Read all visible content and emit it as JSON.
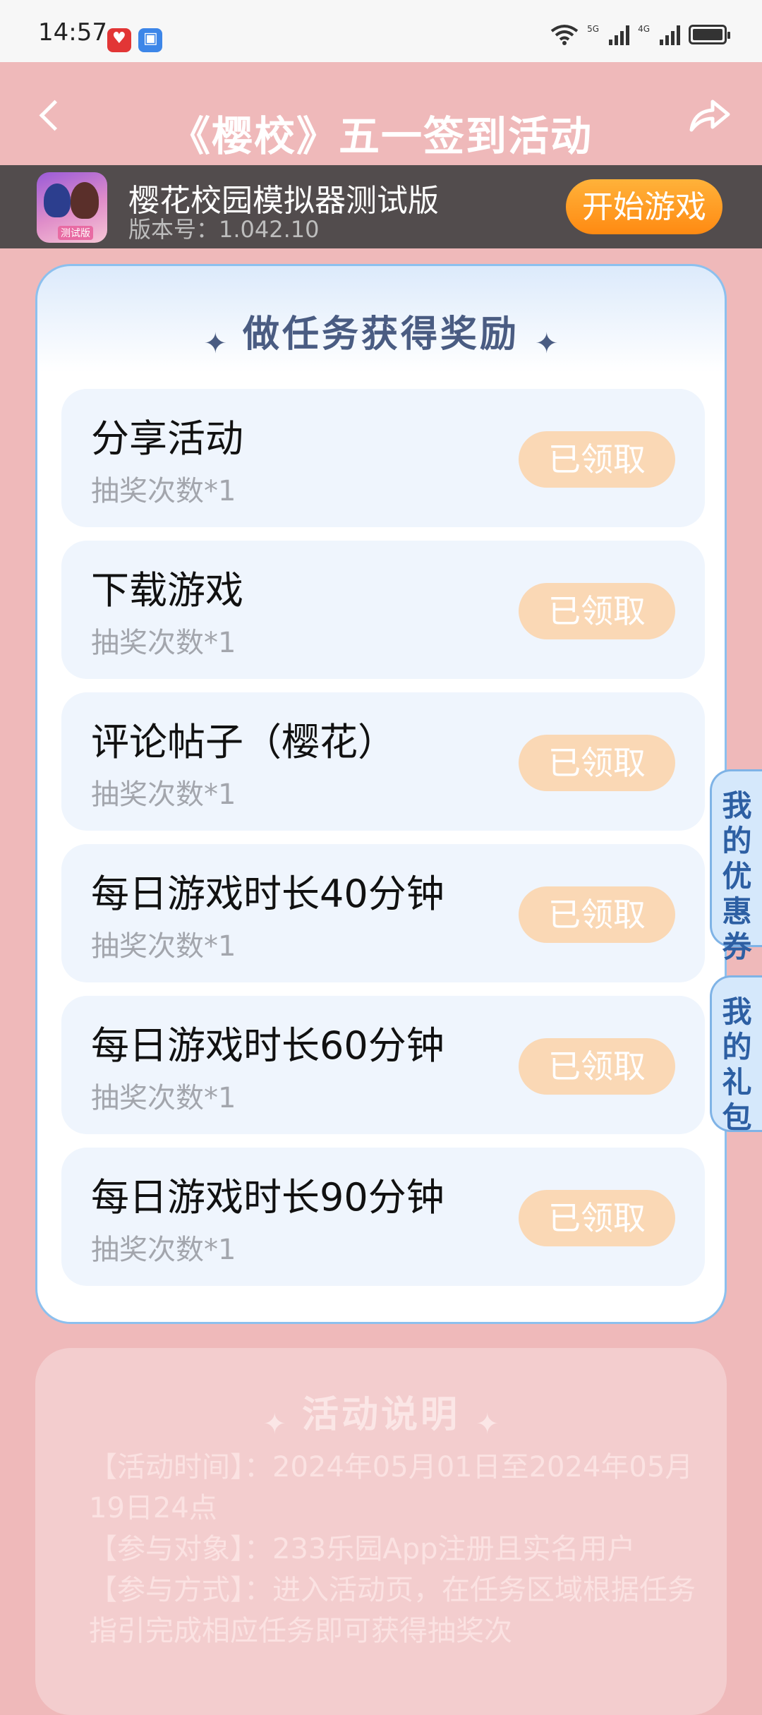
{
  "status_bar": {
    "time": "14:57",
    "notification_icons": [
      "app-red-icon",
      "app-blue-icon"
    ],
    "network_labels": [
      "5G",
      "4G"
    ]
  },
  "header": {
    "title": "《樱校》五一签到活动",
    "back_icon": "chevron-left-icon",
    "share_icon": "share-icon"
  },
  "game_banner": {
    "name": "樱花校园模拟器测试版",
    "version": "版本号：1.042.10",
    "icon_tag": "测试版",
    "start_button": "开始游戏"
  },
  "task_section": {
    "title": "做任务获得奖励",
    "sparkle": "✦",
    "tasks": [
      {
        "name": "分享活动",
        "reward": "抽奖次数*1",
        "button": "已领取"
      },
      {
        "name": "下载游戏",
        "reward": "抽奖次数*1",
        "button": "已领取"
      },
      {
        "name": "评论帖子（樱花）",
        "reward": "抽奖次数*1",
        "button": "已领取"
      },
      {
        "name": "每日游戏时长40分钟",
        "reward": "抽奖次数*1",
        "button": "已领取"
      },
      {
        "name": "每日游戏时长60分钟",
        "reward": "抽奖次数*1",
        "button": "已领取"
      },
      {
        "name": "每日游戏时长90分钟",
        "reward": "抽奖次数*1",
        "button": "已领取"
      }
    ]
  },
  "side_tabs": {
    "coupon": [
      "我",
      "的",
      "优",
      "惠",
      "券"
    ],
    "gift": [
      "我",
      "的",
      "礼",
      "包"
    ]
  },
  "rules_section": {
    "title": "活动说明",
    "lines": [
      "【活动时间】：2024年05月01日至2024年05月19日24点",
      "【参与对象】：233乐园App注册且实名用户",
      "【参与方式】：进入活动页，在任务区域根据任务指引完成相应任务即可获得抽奖次"
    ]
  },
  "colors": {
    "page_background": "#EFB9BA",
    "card_border": "#8CC0EE",
    "claimed_button": "#FAD8B5",
    "start_button": "#FF9A1F",
    "title_text": "#4A5C82"
  }
}
